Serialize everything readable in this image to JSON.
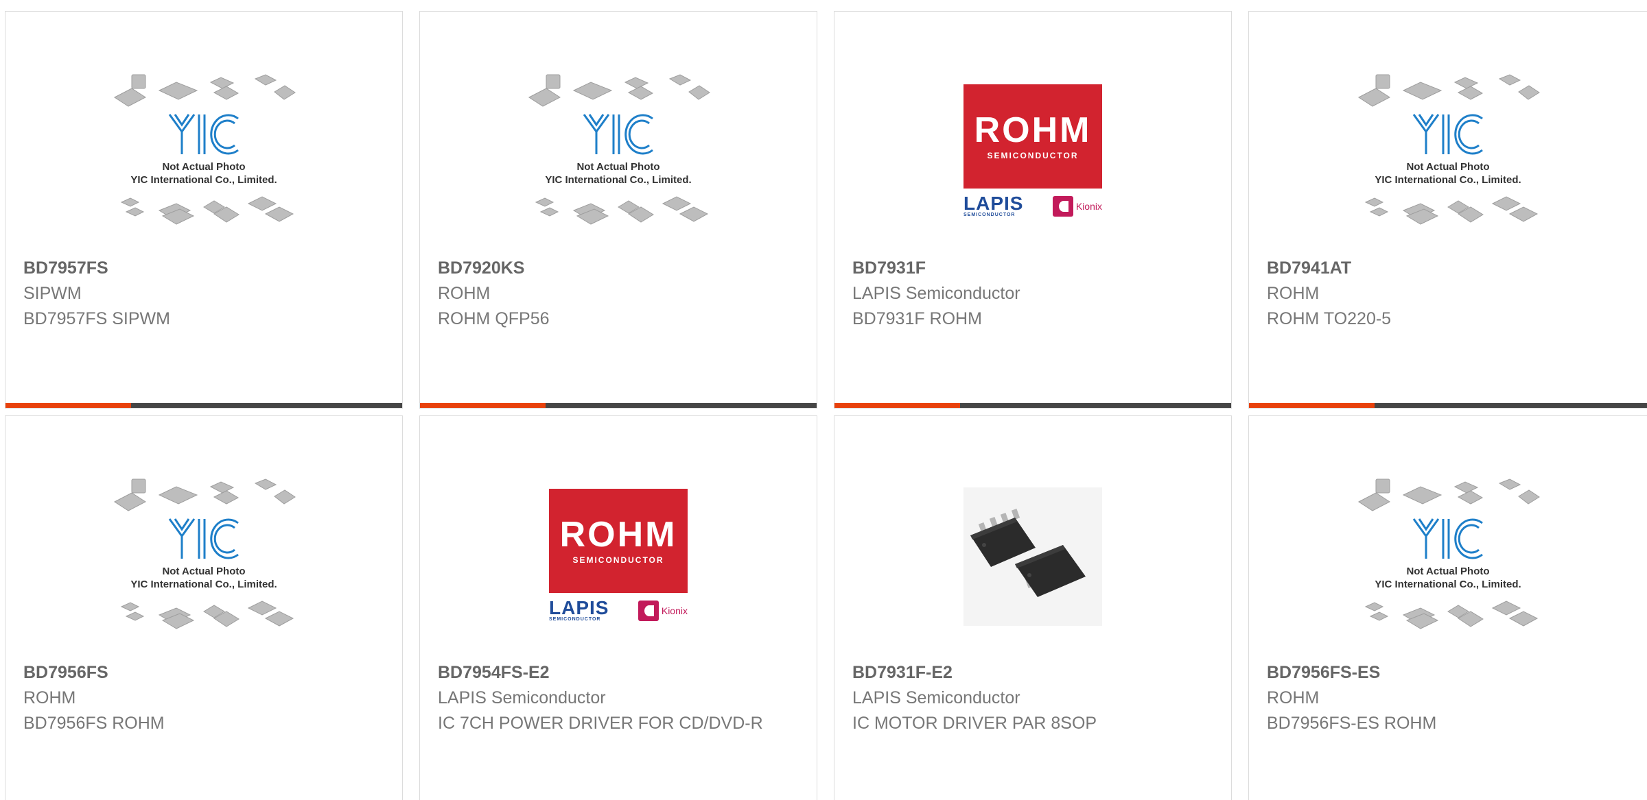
{
  "products": [
    {
      "part_number": "BD7957FS",
      "manufacturer": "SIPWM",
      "description": "BD7957FS SIPWM",
      "image": "yic-placeholder",
      "image_text": [
        "Not Actual Photo",
        "YIC International Co., Limited."
      ]
    },
    {
      "part_number": "BD7920KS",
      "manufacturer": "ROHM",
      "description": "ROHM QFP56",
      "image": "yic-placeholder",
      "image_text": [
        "Not Actual Photo",
        "YIC International Co., Limited."
      ]
    },
    {
      "part_number": "BD7931F",
      "manufacturer": "LAPIS Semiconductor",
      "description": "BD7931F ROHM",
      "image": "rohm-logo",
      "image_text": [
        "ROHM",
        "SEMICONDUCTOR",
        "LAPIS",
        "Kionix"
      ]
    },
    {
      "part_number": "BD7941AT",
      "manufacturer": "ROHM",
      "description": "ROHM TO220-5",
      "image": "yic-placeholder",
      "image_text": [
        "Not Actual Photo",
        "YIC International Co., Limited."
      ]
    },
    {
      "part_number": "BD7956FS",
      "manufacturer": "ROHM",
      "description": "BD7956FS ROHM",
      "image": "yic-placeholder",
      "image_text": [
        "Not Actual Photo",
        "YIC International Co., Limited."
      ]
    },
    {
      "part_number": "BD7954FS-E2",
      "manufacturer": "LAPIS Semiconductor",
      "description": "IC 7CH POWER DRIVER FOR CD/DVD-R",
      "image": "rohm-logo",
      "image_text": [
        "ROHM",
        "SEMICONDUCTOR",
        "LAPIS",
        "Kionix"
      ]
    },
    {
      "part_number": "BD7931F-E2",
      "manufacturer": "LAPIS Semiconductor",
      "description": "IC MOTOR DRIVER PAR 8SOP",
      "image": "ic-photo",
      "image_text": []
    },
    {
      "part_number": "BD7956FS-ES",
      "manufacturer": "ROHM",
      "description": "BD7956FS-ES ROHM",
      "image": "yic-placeholder",
      "image_text": [
        "Not Actual Photo",
        "YIC International Co., Limited."
      ]
    }
  ],
  "colors": {
    "accent": "#e8410c",
    "bar": "#454545",
    "part_number": "#666666",
    "text": "#777777",
    "rohm_red": "#d2232f",
    "lapis_blue": "#1f4c9a",
    "yic_blue": "#1e7fc9"
  }
}
